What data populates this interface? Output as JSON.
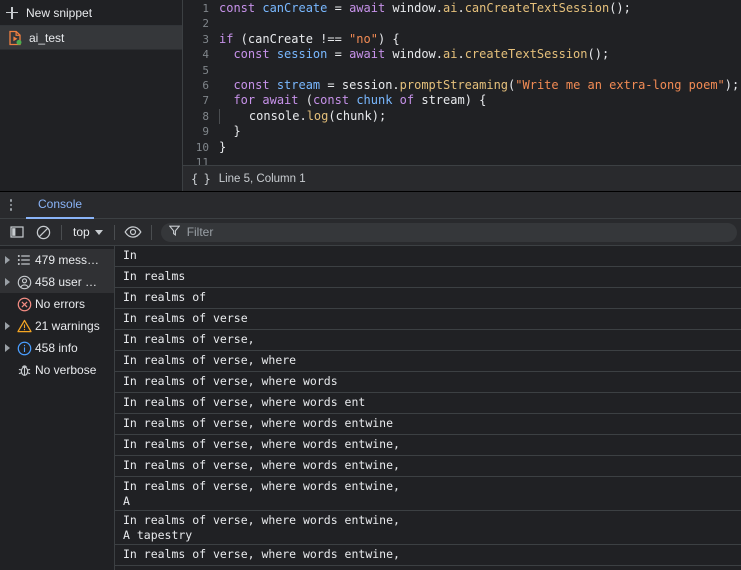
{
  "sources": {
    "new_snippet_label": "New snippet",
    "snippet_name": "ai_test",
    "status_bar": {
      "format_label": "{ }",
      "position": "Line 5, Column 1"
    },
    "code_lines": [
      {
        "n": "1",
        "tokens": [
          {
            "t": "const",
            "c": "tok-kw"
          },
          {
            "t": " ",
            "c": "tok-plain"
          },
          {
            "t": "canCreate",
            "c": "tok-var"
          },
          {
            "t": " = ",
            "c": "tok-plain"
          },
          {
            "t": "await",
            "c": "tok-kw"
          },
          {
            "t": " window.",
            "c": "tok-plain"
          },
          {
            "t": "ai",
            "c": "tok-prop"
          },
          {
            "t": ".",
            "c": "tok-plain"
          },
          {
            "t": "canCreateTextSession",
            "c": "tok-fn"
          },
          {
            "t": "();",
            "c": "tok-plain"
          }
        ]
      },
      {
        "n": "2",
        "tokens": []
      },
      {
        "n": "3",
        "tokens": [
          {
            "t": "if",
            "c": "tok-kw"
          },
          {
            "t": " (canCreate !== ",
            "c": "tok-plain"
          },
          {
            "t": "\"no\"",
            "c": "tok-str"
          },
          {
            "t": ") {",
            "c": "tok-plain"
          }
        ]
      },
      {
        "n": "4",
        "tokens": [
          {
            "t": "  ",
            "c": "tok-plain"
          },
          {
            "t": "const",
            "c": "tok-kw"
          },
          {
            "t": " ",
            "c": "tok-plain"
          },
          {
            "t": "session",
            "c": "tok-var"
          },
          {
            "t": " = ",
            "c": "tok-plain"
          },
          {
            "t": "await",
            "c": "tok-kw"
          },
          {
            "t": " window.",
            "c": "tok-plain"
          },
          {
            "t": "ai",
            "c": "tok-prop"
          },
          {
            "t": ".",
            "c": "tok-plain"
          },
          {
            "t": "createTextSession",
            "c": "tok-fn"
          },
          {
            "t": "();",
            "c": "tok-plain"
          }
        ]
      },
      {
        "n": "5",
        "tokens": []
      },
      {
        "n": "6",
        "tokens": [
          {
            "t": "  ",
            "c": "tok-plain"
          },
          {
            "t": "const",
            "c": "tok-kw"
          },
          {
            "t": " ",
            "c": "tok-plain"
          },
          {
            "t": "stream",
            "c": "tok-var"
          },
          {
            "t": " = session.",
            "c": "tok-plain"
          },
          {
            "t": "promptStreaming",
            "c": "tok-fn"
          },
          {
            "t": "(",
            "c": "tok-plain"
          },
          {
            "t": "\"Write me an extra-long poem\"",
            "c": "tok-str"
          },
          {
            "t": ");",
            "c": "tok-plain"
          }
        ]
      },
      {
        "n": "7",
        "tokens": [
          {
            "t": "  ",
            "c": "tok-plain"
          },
          {
            "t": "for",
            "c": "tok-kw"
          },
          {
            "t": " ",
            "c": "tok-plain"
          },
          {
            "t": "await",
            "c": "tok-kw"
          },
          {
            "t": " (",
            "c": "tok-plain"
          },
          {
            "t": "const",
            "c": "tok-kw"
          },
          {
            "t": " ",
            "c": "tok-plain"
          },
          {
            "t": "chunk",
            "c": "tok-var"
          },
          {
            "t": " ",
            "c": "tok-plain"
          },
          {
            "t": "of",
            "c": "tok-kw"
          },
          {
            "t": " stream) {",
            "c": "tok-plain"
          }
        ]
      },
      {
        "n": "8",
        "indent_guide": true,
        "tokens": [
          {
            "t": "    console.",
            "c": "tok-plain"
          },
          {
            "t": "log",
            "c": "tok-fn"
          },
          {
            "t": "(chunk);",
            "c": "tok-plain"
          }
        ]
      },
      {
        "n": "9",
        "tokens": [
          {
            "t": "  }",
            "c": "tok-plain"
          }
        ]
      },
      {
        "n": "10",
        "tokens": [
          {
            "t": "}",
            "c": "tok-plain"
          }
        ]
      },
      {
        "n": "11",
        "tokens": []
      }
    ]
  },
  "drawer": {
    "tab_label": "Console",
    "toolbar": {
      "sidebar_toggle_name": "show-console-sidebar",
      "clear_label": "clear-console",
      "context_value": "top",
      "eye_label": "live-expression",
      "filter_placeholder": "Filter",
      "filter_value": ""
    },
    "sidebar": [
      {
        "label": "479 mess…",
        "icon": "list-icon",
        "expandable": true,
        "selected": true,
        "color": "#c8ccd0"
      },
      {
        "label": "458 user …",
        "icon": "user-icon",
        "expandable": true,
        "selected": true,
        "color": "#c8ccd0"
      },
      {
        "label": "No errors",
        "icon": "error-icon",
        "expandable": false,
        "selected": false,
        "color": "#f28b82"
      },
      {
        "label": "21 warnings",
        "icon": "warning-icon",
        "expandable": true,
        "selected": false,
        "color": "#f5a623"
      },
      {
        "label": "458 info",
        "icon": "info-icon",
        "expandable": true,
        "selected": false,
        "color": "#4a9eff"
      },
      {
        "label": "No verbose",
        "icon": "bug-icon",
        "expandable": false,
        "selected": false,
        "color": "#c8ccd0"
      }
    ],
    "messages": [
      "In",
      "In realms",
      "In realms of",
      "In realms of verse",
      "In realms of verse,",
      "In realms of verse, where",
      "In realms of verse, where words",
      "In realms of verse, where words ent",
      "In realms of verse, where words entwine",
      "In realms of verse, where words entwine,",
      "In realms of verse, where words entwine,",
      "In realms of verse, where words entwine,\nA",
      "In realms of verse, where words entwine,\nA tapestry",
      "In realms of verse, where words entwine,"
    ]
  }
}
